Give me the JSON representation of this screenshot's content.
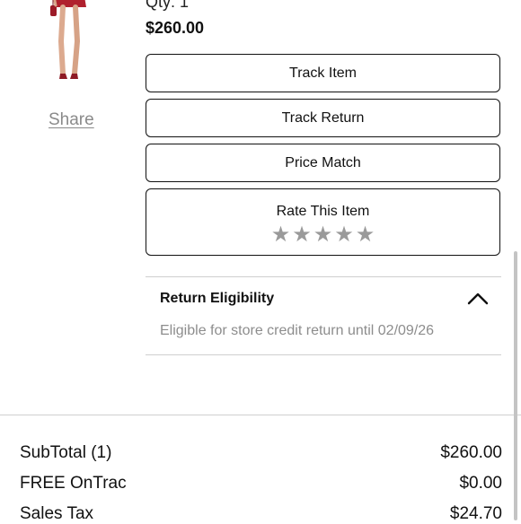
{
  "order_item": {
    "qty_label": "Qty: 1",
    "price": "$260.00",
    "share_label": "Share"
  },
  "actions": {
    "track_item": "Track Item",
    "track_return": "Track Return",
    "price_match": "Price Match"
  },
  "rating": {
    "label": "Rate This Item",
    "stars": [
      "★",
      "★",
      "★",
      "★",
      "★"
    ],
    "star_color": "#9a9a9a"
  },
  "return_eligibility": {
    "title": "Return Eligibility",
    "expanded": true,
    "message": "Eligible for store credit return until 02/09/26",
    "chevron_icon": "chevron-up-icon"
  },
  "summary": {
    "subtotal_label": "SubTotal (1)",
    "subtotal_value": "$260.00",
    "shipping_label": "FREE OnTrac",
    "shipping_value": "$0.00",
    "tax_label": "Sales Tax",
    "tax_value": "$24.70"
  },
  "colors": {
    "text": "#111111",
    "muted": "#8d8d8d",
    "product_dress": "#b0202e"
  }
}
